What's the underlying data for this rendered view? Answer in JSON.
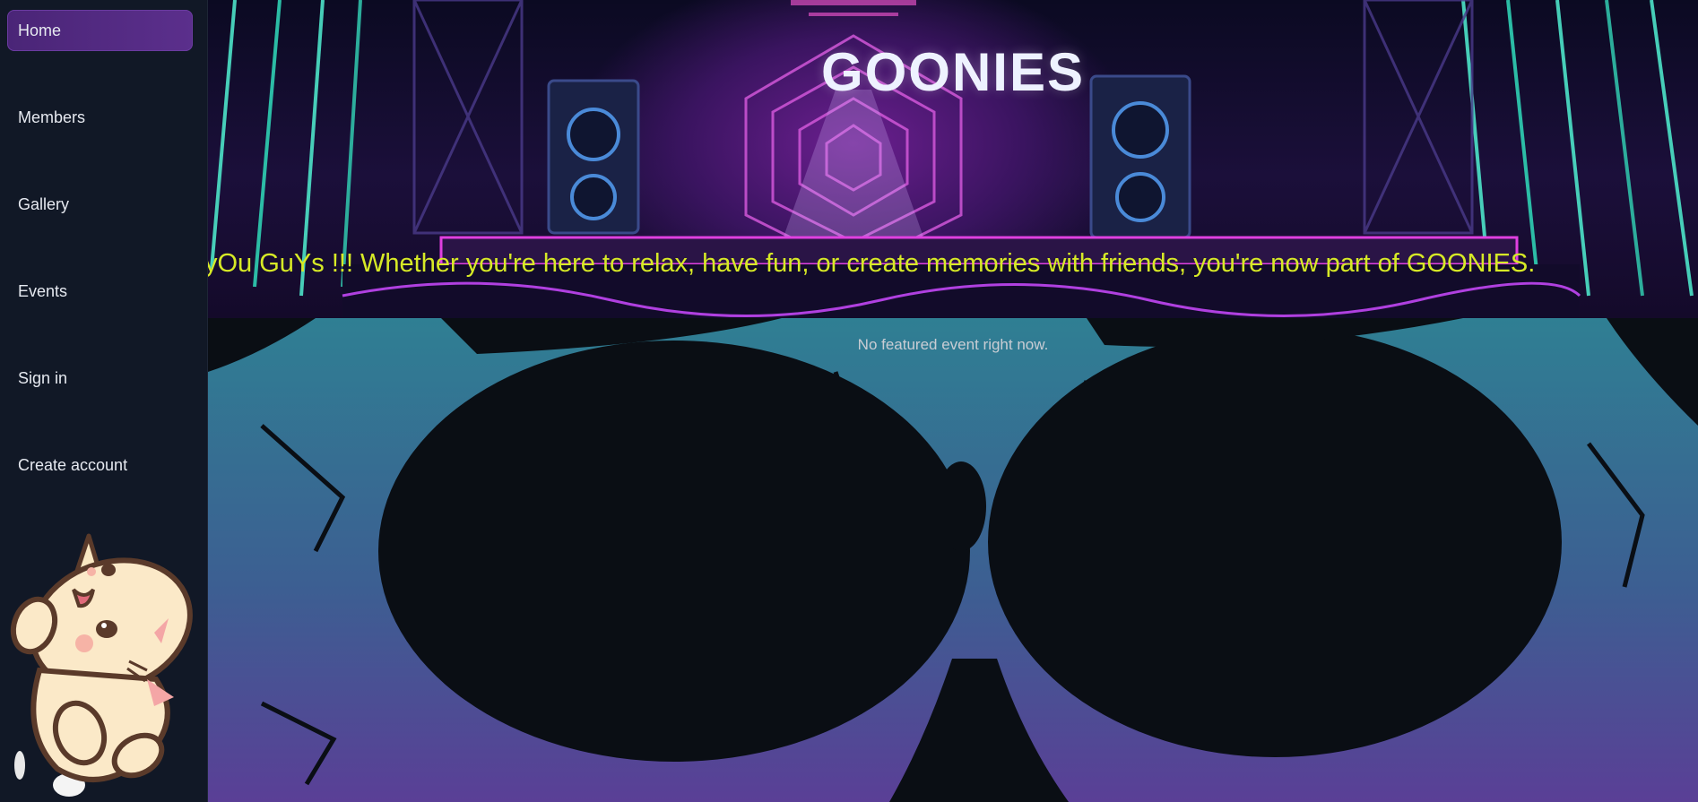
{
  "sidebar": {
    "items": [
      {
        "label": "Home",
        "active": true
      },
      {
        "label": "Members",
        "active": false
      },
      {
        "label": "Gallery",
        "active": false
      },
      {
        "label": "Events",
        "active": false
      },
      {
        "label": "Sign in",
        "active": false
      },
      {
        "label": "Create account",
        "active": false
      }
    ],
    "mascot_icon": "waving-cat-icon"
  },
  "hero": {
    "title": "GOONIES",
    "marquee_text": "yOu GuYs !!! Whether you're here to relax, have fun, or create memories with friends, you're now part of GOONIES."
  },
  "main": {
    "featured_message": "No featured event right now."
  },
  "colors": {
    "sidebar_bg": "#111826",
    "active_item": "#5b2f8c",
    "marquee_text": "#d7ea26",
    "page_bg": "#0a0e14",
    "skull_tint_top": "#2f7f93",
    "skull_tint_bottom": "#5a3f96"
  }
}
